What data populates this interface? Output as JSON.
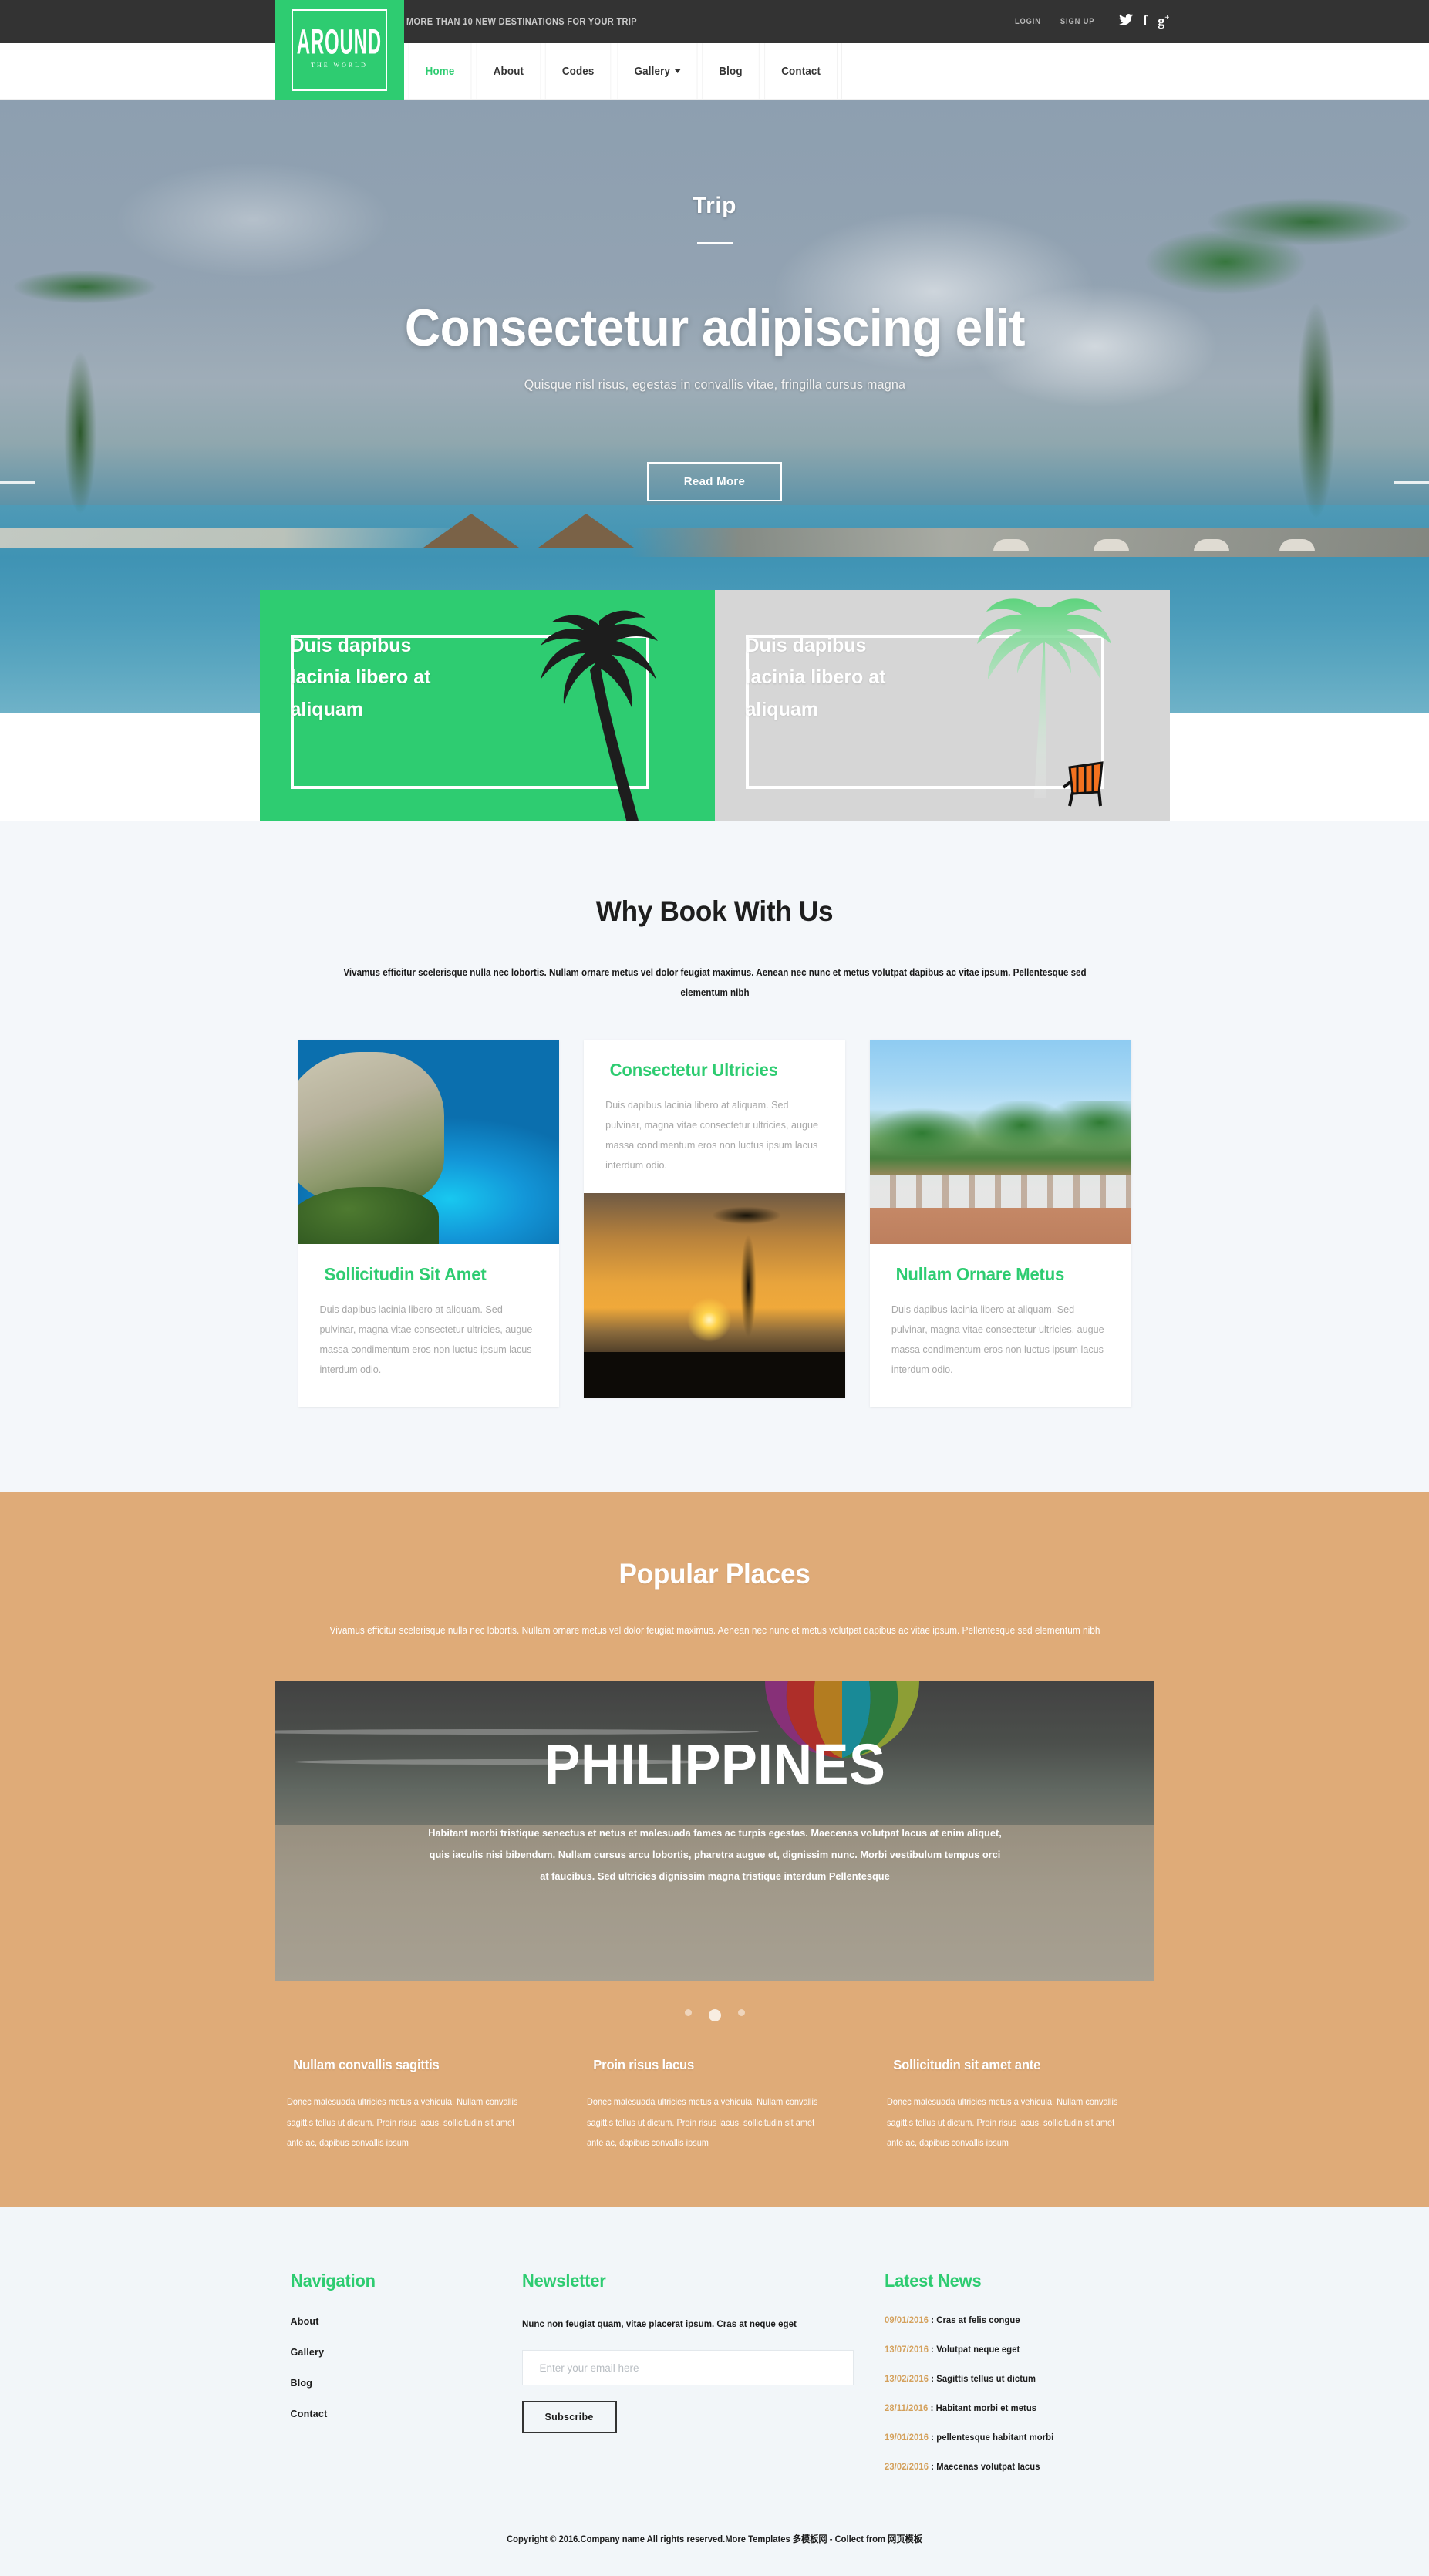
{
  "topbar": {
    "tagline": "MORE THAN 10 NEW DESTINATIONS FOR YOUR TRIP",
    "login": "LOGIN",
    "signup": "SIGN UP",
    "social": [
      {
        "name": "twitter-icon",
        "glyph": "🐦"
      },
      {
        "name": "facebook-icon",
        "glyph": "f"
      },
      {
        "name": "googleplus-icon",
        "glyph": "g+"
      }
    ]
  },
  "logo": {
    "title": "AROUND",
    "subtitle": "THE WORLD"
  },
  "nav": {
    "items": [
      {
        "label": "Home",
        "active": true,
        "caret": false
      },
      {
        "label": "About",
        "active": false,
        "caret": false
      },
      {
        "label": "Codes",
        "active": false,
        "caret": false
      },
      {
        "label": "Gallery",
        "active": false,
        "caret": true
      },
      {
        "label": "Blog",
        "active": false,
        "caret": false
      },
      {
        "label": "Contact",
        "active": false,
        "caret": false
      }
    ]
  },
  "hero": {
    "kicker": "Trip",
    "title": "Consectetur adipiscing elit",
    "subtitle": "Quisque nisl risus, egestas in convallis vitae, fringilla cursus magna",
    "button": "Read More",
    "dots": 3,
    "active_dot": 1
  },
  "promos": [
    {
      "text": "Duis dapibus lacinia libero at aliquam",
      "style": "green"
    },
    {
      "text": "Duis dapibus lacinia libero at aliquam",
      "style": "gray"
    }
  ],
  "why": {
    "title": "Why Book With Us",
    "subtitle": "Vivamus efficitur scelerisque nulla nec lobortis. Nullam ornare metus vel dolor feugiat maximus. Aenean nec nunc et metus volutpat dapibus ac vitae ipsum. Pellentesque sed elementum nibh",
    "cards": [
      {
        "title": "Sollicitudin Sit Amet",
        "text": "Duis dapibus lacinia libero at aliquam. Sed pulvinar, magna vitae consectetur ultricies, augue massa condimentum eros non luctus ipsum lacus interdum odio.",
        "image": "cliff-cove-beach",
        "image_position": "top"
      },
      {
        "title": "Consectetur Ultricies",
        "text": "Duis dapibus lacinia libero at aliquam. Sed pulvinar, magna vitae consectetur ultricies, augue massa condimentum eros non luctus ipsum lacus interdum odio.",
        "image": "palm-sunset-beach",
        "image_position": "bottom"
      },
      {
        "title": "Nullam Ornare Metus",
        "text": "Duis dapibus lacinia libero at aliquam. Sed pulvinar, magna vitae consectetur ultricies, augue massa condimentum eros non luctus ipsum lacus interdum odio.",
        "image": "resort-palms-loungers",
        "image_position": "top"
      }
    ]
  },
  "places": {
    "title": "Popular Places",
    "subtitle": "Vivamus efficitur scelerisque nulla nec lobortis. Nullam ornare metus vel dolor feugiat maximus. Aenean nec nunc et metus volutpat dapibus ac vitae ipsum. Pellentesque sed elementum nibh",
    "banner": {
      "title": "PHILIPPINES",
      "text": "Habitant morbi tristique senectus et netus et malesuada fames ac turpis egestas. Maecenas volutpat lacus at enim aliquet, quis iaculis nisi bibendum. Nullam cursus arcu lobortis, pharetra augue et, dignissim nunc. Morbi vestibulum tempus orci at faucibus. Sed ultricies dignissim magna tristique interdum Pellentesque"
    },
    "dots": 3,
    "active_dot": 1,
    "columns": [
      {
        "title": "Nullam convallis sagittis",
        "text": "Donec malesuada ultricies metus a vehicula. Nullam convallis sagittis tellus ut dictum. Proin risus lacus, sollicitudin sit amet ante ac, dapibus convallis ipsum"
      },
      {
        "title": "Proin risus lacus",
        "text": "Donec malesuada ultricies metus a vehicula. Nullam convallis sagittis tellus ut dictum. Proin risus lacus, sollicitudin sit amet ante ac, dapibus convallis ipsum"
      },
      {
        "title": "Sollicitudin sit amet ante",
        "text": "Donec malesuada ultricies metus a vehicula. Nullam convallis sagittis tellus ut dictum. Proin risus lacus, sollicitudin sit amet ante ac, dapibus convallis ipsum"
      }
    ]
  },
  "footer": {
    "navigation": {
      "heading": "Navigation",
      "links": [
        "About",
        "Gallery",
        "Blog",
        "Contact"
      ]
    },
    "newsletter": {
      "heading": "Newsletter",
      "text": "Nunc non feugiat quam, vitae placerat ipsum. Cras at neque eget",
      "placeholder": "Enter your email here",
      "button": "Subscribe"
    },
    "latest_news": {
      "heading": "Latest News",
      "items": [
        {
          "date": "09/01/2016",
          "title": "Cras at felis congue"
        },
        {
          "date": "13/07/2016",
          "title": "Volutpat neque eget"
        },
        {
          "date": "13/02/2016",
          "title": "Sagittis tellus ut dictum"
        },
        {
          "date": "28/11/2016",
          "title": "Habitant morbi et metus"
        },
        {
          "date": "19/01/2016",
          "title": "pellentesque habitant morbi"
        },
        {
          "date": "23/02/2016",
          "title": "Maecenas volutpat lacus"
        }
      ]
    },
    "copyright": "Copyright © 2016.Company name All rights reserved.More Templates 多模板网 - Collect from 网页模板"
  },
  "colors": {
    "brand_green": "#2ecc71",
    "dark_bar": "#333333",
    "sand": "#dfab78",
    "light_bg": "#f4f7fa",
    "footer_bg": "#f2f6f9",
    "news_date": "#d4a15d"
  }
}
